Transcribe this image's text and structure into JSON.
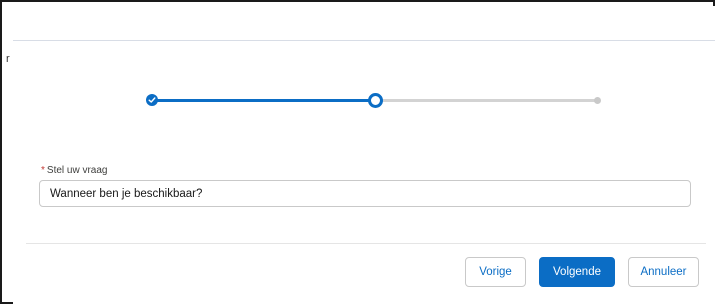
{
  "side_mark": "r",
  "progress": {
    "steps": [
      {
        "status": "complete"
      },
      {
        "status": "current"
      },
      {
        "status": "upcoming"
      }
    ],
    "active_color": "#0b6dc5",
    "inactive_color": "#d3d3d3",
    "complete_icon": "check-icon"
  },
  "question_field": {
    "required_marker": "*",
    "label": "Stel uw vraag",
    "value": "Wanneer ben je beschikbaar?"
  },
  "footer": {
    "previous_label": "Vorige",
    "next_label": "Volgende",
    "cancel_label": "Annuleer"
  }
}
